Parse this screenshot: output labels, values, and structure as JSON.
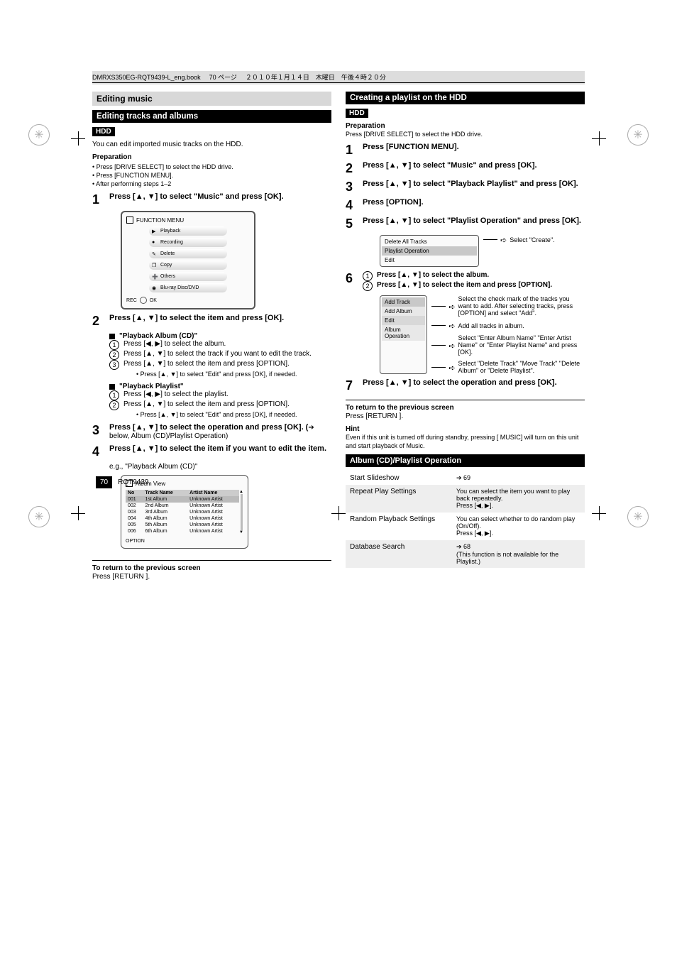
{
  "banner": {
    "file": "DMRXS350EG-RQT9439-L_eng.book",
    "page_jp": "70 ページ",
    "date_jp": "２０１０年１月１４日　木曜日　午後４時２０分"
  },
  "chapter": "Editing music",
  "left": {
    "section_title": "Editing tracks and albums",
    "badge": "HDD",
    "intro": "You can edit imported music tracks on the HDD.",
    "preparation_h": "Preparation",
    "prep_items": [
      "Press [DRIVE SELECT] to select the HDD drive.",
      "Press [FUNCTION MENU].",
      "After performing steps 1–2"
    ],
    "step1": {
      "label": "1",
      "text_a": "Press [",
      "text_b": "] to select \"Music\" and press [OK]."
    },
    "screen1": {
      "title": "FUNCTION MENU",
      "items": [
        "Playback",
        "Recording",
        "Delete",
        "Copy",
        "Others",
        "Blu-ray Disc/DVD"
      ],
      "footer_ok": "OK",
      "rec_label": "REC"
    },
    "step2": {
      "label": "2",
      "text_a": "Press [",
      "text_b": "] to select the item and press [OK]."
    },
    "block_album": {
      "title": "\"Playback Album (CD)\"",
      "sub1": {
        "n": "1",
        "text_a": "Press [",
        "text_b": "] to select the album."
      },
      "sub2": {
        "n": "2",
        "text_a": "Press [",
        "text_b": "] to select the track if you want to edit the track."
      },
      "sub3": {
        "n": "3",
        "text_a": "Press [",
        "text_b": "] to select the item and press [OPTION]."
      },
      "note": "Press [",
      "note2": "] to select \"Edit\" and press [OK], if needed."
    },
    "block_playlist": {
      "title": "\"Playback Playlist\"",
      "sub1": {
        "n": "1",
        "text_a": "Press [",
        "text_b": "] to select the playlist."
      },
      "sub2": {
        "n": "2",
        "text_a": "Press [",
        "text_b": "] to select the item and press [OPTION]."
      },
      "note": "Press [",
      "note2": "] to select \"Edit\" and press [OK], if needed."
    },
    "step3": {
      "label": "3",
      "text_a": "Press [",
      "text_b": "] to select the operation and press [OK]. (",
      "ref": "➔ below, Album (CD)/Playlist Operation)"
    },
    "step4": {
      "label": "4",
      "text_a": "Press [",
      "text_b": "] to select the item if you want to edit the item."
    },
    "eg": "e.g., \"Playback Album (CD)\"",
    "screen2": {
      "title": "Album View",
      "headers": [
        "No",
        "Track Name",
        "Artist Name"
      ],
      "rows": [
        [
          "001",
          "1st Album",
          "Unknown Artist"
        ],
        [
          "002",
          "2nd Album",
          "Unknown Artist"
        ],
        [
          "003",
          "3rd Album",
          "Unknown Artist"
        ],
        [
          "004",
          "4th Album",
          "Unknown Artist"
        ],
        [
          "005",
          "5th Album",
          "Unknown Artist"
        ],
        [
          "006",
          "6th Album",
          "Unknown Artist"
        ]
      ],
      "footer": "OPTION"
    },
    "return_h": "To return to the previous screen",
    "return_t": "Press [RETURN   ]."
  },
  "right": {
    "section_title": "Creating a playlist on the HDD",
    "badge": "HDD",
    "prep_t1": "Preparation",
    "prep_t2": "Press [DRIVE SELECT] to select the HDD drive.",
    "step1": {
      "label": "1",
      "text": "Press [FUNCTION MENU]."
    },
    "step2": {
      "label": "2",
      "text_a": "Press [",
      "text_b": "] to select \"Music\" and press [OK]."
    },
    "step3": {
      "label": "3",
      "text_a": "Press [",
      "text_b": "] to select \"Playback Playlist\" and press [OK]."
    },
    "step4": {
      "label": "4",
      "text": "Press [OPTION]."
    },
    "step5": {
      "label": "5",
      "text_a": "Press [",
      "text_b": "] to select \"Playlist Operation\" and press [OK]."
    },
    "screen_r1": {
      "items": [
        "Delete All Tracks",
        "Playlist Operation",
        "Edit"
      ],
      "sel": 1,
      "anno": "Select \"Create\"."
    },
    "step6": {
      "label": "6",
      "sub1_n": "1",
      "sub1_a": "Press [",
      "sub1_b": "] to select the album.",
      "sub2_n": "2",
      "sub2_a": "Press [",
      "sub2_b": "] to select the item and press [OPTION]."
    },
    "screen_r2": {
      "items": [
        "Add Track",
        "Add Album",
        "Edit",
        "Album Operation"
      ],
      "annos": [
        "Select the check mark of the tracks you want to add. After selecting tracks, press [OPTION] and select \"Add\".",
        "Add all tracks in album.",
        "Select \"Enter Album Name\" \"Enter Artist Name\" or \"Enter Playlist Name\" and press [OK].",
        "Select \"Delete Track\" \"Move Track\" \"Delete Album\" or \"Delete Playlist\"."
      ]
    },
    "step7": {
      "label": "7",
      "text_a": "Press [",
      "text_b": "] to select the operation and press [OK]."
    },
    "return_h": "To return to the previous screen",
    "return_t": "Press [RETURN   ].",
    "hint_h": "Hint",
    "hint_t": "Even if this unit is turned off during standby, pressing [   MUSIC] will turn on this unit and start playback of Music.",
    "opt_header": "Album (CD)/Playlist Operation",
    "opt_rows": [
      {
        "l": "Start Slideshow",
        "r": "➔ 69"
      },
      {
        "l": "Repeat Play Settings",
        "r_a": "You can select the item you want to play back repeatedly.",
        "r_b": "Press [◀, ▶]."
      },
      {
        "l": "Random Playback Settings",
        "r_a": "You can select whether to do random play (On/Off).",
        "r_b": "Press [◀, ▶]."
      },
      {
        "l": "Database Search",
        "r_a": "➔ 68",
        "r_b": "(This function is not available for the Playlist.)"
      }
    ]
  },
  "footer": {
    "pg": "70",
    "code": "RQT9439"
  }
}
